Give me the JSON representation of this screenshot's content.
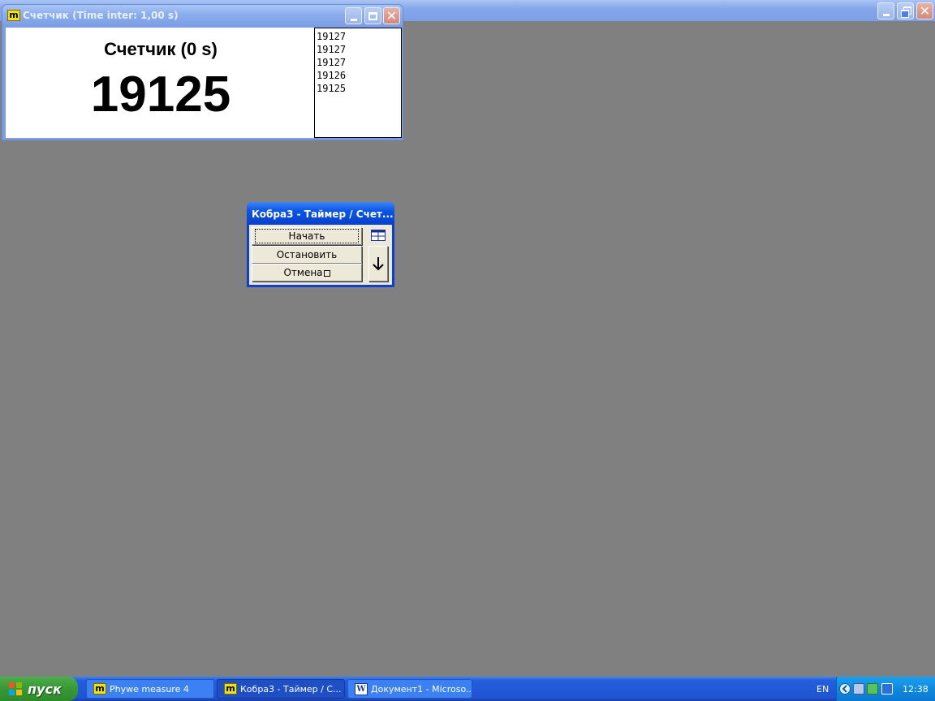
{
  "counter_window": {
    "title": "Счетчик (Time inter: 1,00 s)",
    "icon_letter": "m",
    "heading": "Счетчик (0 s)",
    "value": "19125",
    "history": [
      "19127",
      "19127",
      "19127",
      "19126",
      "19125"
    ]
  },
  "tool_window": {
    "title": "Кобра3 - Таймер / Счет...",
    "buttons": {
      "start": "Начать",
      "stop": "Остановить",
      "cancel": "Отмена"
    }
  },
  "taskbar": {
    "start_label": "пуск",
    "tasks": [
      {
        "label": "Phywe measure 4",
        "icon": "m"
      },
      {
        "label": "Кобра3 - Таймер / С...",
        "icon": "m"
      },
      {
        "label": "Документ1 - Microso...",
        "icon": "W"
      }
    ],
    "language": "EN",
    "clock": "12:38"
  },
  "colors": {
    "desktop": "#808080",
    "taskbar": "#245edb",
    "start": "#3a9b37",
    "tray": "#0f8ae0"
  }
}
